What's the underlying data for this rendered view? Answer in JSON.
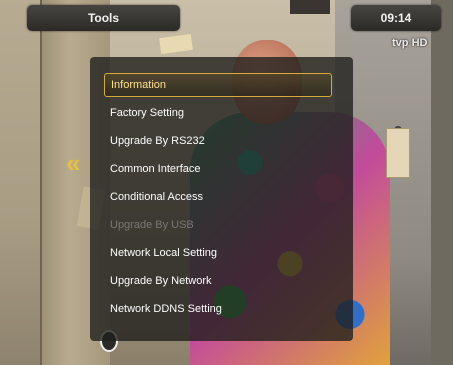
{
  "header": {
    "title": "Tools",
    "time": "09:14",
    "channel_logo": "tvp",
    "channel_logo_hd": "HD"
  },
  "menu": {
    "items": [
      {
        "label": "Information",
        "state": "selected"
      },
      {
        "label": "Factory Setting",
        "state": "normal"
      },
      {
        "label": "Upgrade By RS232",
        "state": "normal"
      },
      {
        "label": "Common Interface",
        "state": "normal"
      },
      {
        "label": "Conditional Access",
        "state": "normal"
      },
      {
        "label": "Upgrade By USB",
        "state": "disabled"
      },
      {
        "label": "Network Local Setting",
        "state": "normal"
      },
      {
        "label": "Upgrade By Network",
        "state": "normal"
      },
      {
        "label": "Network DDNS Setting",
        "state": "normal"
      }
    ]
  },
  "colors": {
    "accent": "#d7a93b",
    "menu_text": "#ffffff",
    "disabled_text": "#7a7874",
    "bar_bg": "#2b2a27"
  }
}
